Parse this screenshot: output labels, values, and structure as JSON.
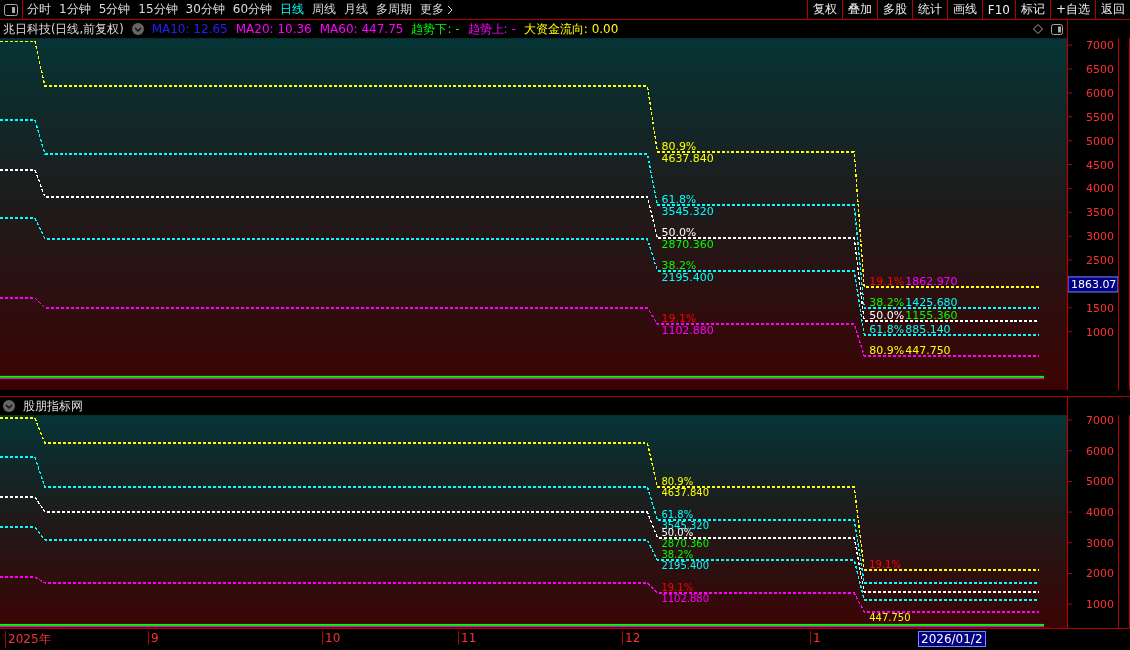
{
  "toolbar": {
    "tabs": [
      {
        "label": "分时",
        "selected": false
      },
      {
        "label": "1分钟",
        "selected": false
      },
      {
        "label": "5分钟",
        "selected": false
      },
      {
        "label": "15分钟",
        "selected": false
      },
      {
        "label": "30分钟",
        "selected": false
      },
      {
        "label": "60分钟",
        "selected": false
      },
      {
        "label": "日线",
        "selected": true
      },
      {
        "label": "周线",
        "selected": false
      },
      {
        "label": "月线",
        "selected": false
      },
      {
        "label": "多周期",
        "selected": false
      },
      {
        "label": "更多",
        "selected": false
      }
    ],
    "buttons": [
      "复权",
      "叠加",
      "多股",
      "统计",
      "画线",
      "F10",
      "标记",
      "+自选",
      "返回"
    ]
  },
  "main_panel": {
    "title": "兆日科技(日线,前复权)",
    "indicators": [
      {
        "text": "MA10: 12.65",
        "color": "#2020ff"
      },
      {
        "text": "MA20: 10.36",
        "color": "#ff00ff"
      },
      {
        "text": "MA60: 447.75",
        "color": "#ff00ff"
      },
      {
        "text": "趋势下: -",
        "color": "#00ff00"
      },
      {
        "text": "趋势上: -",
        "color": "#ff00ff"
      },
      {
        "text": "大资金流向: 0.00",
        "color": "#ffff00"
      }
    ],
    "axis": [
      {
        "kind": "tick",
        "text": "7000"
      },
      {
        "kind": "tick",
        "text": "6500"
      },
      {
        "kind": "tick",
        "text": "6000"
      },
      {
        "kind": "tick",
        "text": "5500"
      },
      {
        "kind": "tick",
        "text": "5000"
      },
      {
        "kind": "tick",
        "text": "4500"
      },
      {
        "kind": "tick",
        "text": "4000"
      },
      {
        "kind": "tick",
        "text": "3500"
      },
      {
        "kind": "tick",
        "text": "3000"
      },
      {
        "kind": "tick",
        "text": "2500"
      },
      {
        "kind": "tag",
        "text": "1863.07"
      },
      {
        "kind": "tick",
        "text": "1500"
      },
      {
        "kind": "tick",
        "text": "1000"
      }
    ],
    "levels": [
      {
        "color": "#ffff00",
        "pct": {
          "text": "80.9%",
          "color": "#ffff00"
        },
        "value": {
          "text": "4637.840",
          "color": "#ffff00"
        },
        "recent_pct": {
          "text": "19.1%",
          "color": "#ff0000"
        },
        "recent_value": {
          "text": "1862.970",
          "color": "#ff00ff"
        }
      },
      {
        "color": "#00ffff",
        "pct": {
          "text": "61.8%",
          "color": "#00ffff"
        },
        "value": {
          "text": "3545.320",
          "color": "#00ffff"
        },
        "recent_pct": {
          "text": "38.2%",
          "color": "#00ff00"
        },
        "recent_value": {
          "text": "1425.680",
          "color": "#00ffff"
        }
      },
      {
        "color": "#ffffff",
        "pct": {
          "text": "50.0%",
          "color": "#ffffff"
        },
        "value": {
          "text": "2870.360",
          "color": "#00ff00"
        },
        "recent_pct": {
          "text": "50.0%",
          "color": "#ffffff"
        },
        "recent_value": {
          "text": "1155.360",
          "color": "#00ff00"
        }
      },
      {
        "color": "#00ffff",
        "pct": {
          "text": "38.2%",
          "color": "#00ff00"
        },
        "value": {
          "text": "2195.400",
          "color": "#00ffff"
        },
        "recent_pct": {
          "text": "61.8%",
          "color": "#00ffff"
        },
        "recent_value": {
          "text": "885.140",
          "color": "#00ffff"
        }
      },
      {
        "color": "#ff00ff",
        "pct": {
          "text": "19.1%",
          "color": "#ff0000"
        },
        "value": {
          "text": "1102.880",
          "color": "#ff00ff"
        },
        "recent_pct": {
          "text": "80.9%",
          "color": "#ffff00"
        },
        "recent_value": {
          "text": "447.750",
          "color": "#ffff00"
        }
      }
    ]
  },
  "sub_panel": {
    "title": "股朋指标网",
    "axis": [
      {
        "kind": "tick",
        "text": "7000"
      },
      {
        "kind": "tick",
        "text": "6000"
      },
      {
        "kind": "tick",
        "text": "5000"
      },
      {
        "kind": "tick",
        "text": "4000"
      },
      {
        "kind": "tick",
        "text": "3000"
      },
      {
        "kind": "tick",
        "text": "2000"
      },
      {
        "kind": "tick",
        "text": "1000"
      }
    ],
    "levels": [
      {
        "color": "#ffff00",
        "pct": {
          "text": "80.9%",
          "color": "#ffff00"
        },
        "value": {
          "text": "4637.840",
          "color": "#ffff00"
        },
        "recent_pct": {
          "text": "19.1%",
          "color": "#ff0000"
        }
      },
      {
        "color": "#00ffff",
        "pct": {
          "text": "61.8%",
          "color": "#00ffff"
        },
        "value": {
          "text": "3545.320",
          "color": "#00ffff"
        }
      },
      {
        "color": "#ffffff",
        "pct": {
          "text": "50.0%",
          "color": "#ffffff"
        },
        "value": {
          "text": "2870.360",
          "color": "#00ff00"
        }
      },
      {
        "color": "#00ffff",
        "pct": {
          "text": "38.2%",
          "color": "#00ff00"
        },
        "value": {
          "text": "2195.400",
          "color": "#00ffff"
        }
      },
      {
        "color": "#ff00ff",
        "pct": {
          "text": "19.1%",
          "color": "#ff0000"
        },
        "value": {
          "text": "1102.880",
          "color": "#ff00ff"
        },
        "recent_value": {
          "text": "447.750",
          "color": "#ffff00"
        }
      }
    ]
  },
  "time_axis": [
    {
      "kind": "label",
      "text": "2025年"
    },
    {
      "kind": "label",
      "text": "9"
    },
    {
      "kind": "label",
      "text": "10"
    },
    {
      "kind": "label",
      "text": "11"
    },
    {
      "kind": "label",
      "text": "12"
    },
    {
      "kind": "label",
      "text": "1"
    },
    {
      "kind": "cursor",
      "text": "2026/01/2"
    }
  ]
}
